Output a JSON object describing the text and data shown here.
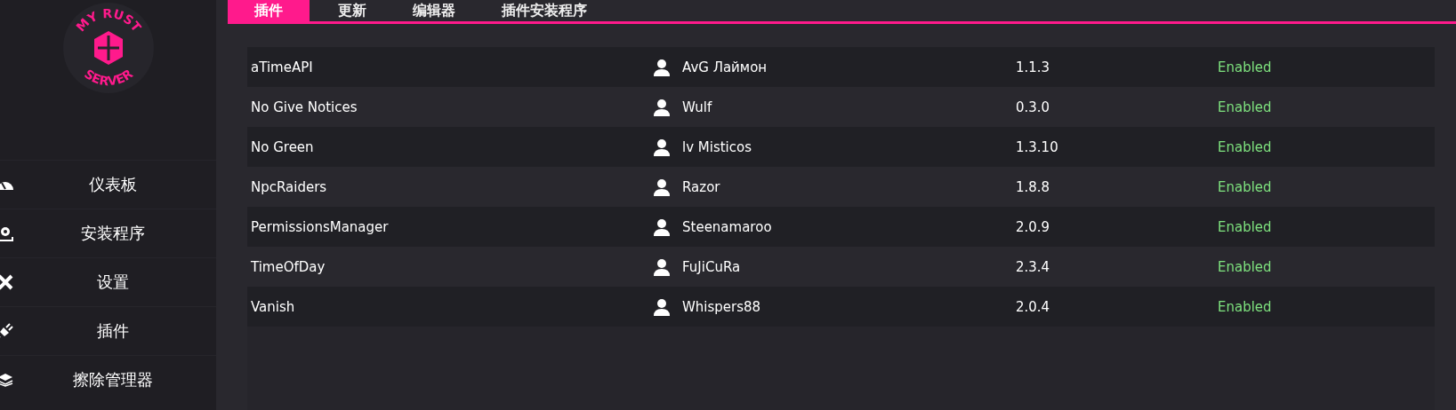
{
  "logo": {
    "top_text": "MY RUST",
    "bottom_text": "SERVER"
  },
  "sidebar": {
    "items": [
      {
        "label": "仪表板"
      },
      {
        "label": "安装程序"
      },
      {
        "label": "设置"
      },
      {
        "label": "插件"
      },
      {
        "label": "擦除管理器"
      }
    ]
  },
  "tabs": [
    {
      "label": "插件",
      "selected": true
    },
    {
      "label": "更新",
      "selected": false
    },
    {
      "label": "编辑器",
      "selected": false
    },
    {
      "label": "插件安装程序",
      "selected": false
    }
  ],
  "plugins": [
    {
      "name": "aTimeAPI",
      "author": "AvG Лаймон",
      "version": "1.1.3",
      "status": "Enabled",
      "enabled": true
    },
    {
      "name": "No Give Notices",
      "author": "Wulf",
      "version": "0.3.0",
      "status": "Enabled",
      "enabled": true
    },
    {
      "name": "No Green",
      "author": "lv Misticos",
      "version": "1.3.10",
      "status": "Enabled",
      "enabled": true
    },
    {
      "name": "NpcRaiders",
      "author": "Razor",
      "version": "1.8.8",
      "status": "Enabled",
      "enabled": true
    },
    {
      "name": "PermissionsManager",
      "author": "Steenamaroo",
      "version": "2.0.9",
      "status": "Enabled",
      "enabled": true
    },
    {
      "name": "TimeOfDay",
      "author": "FuJiCuRa",
      "version": "2.3.4",
      "status": "Enabled",
      "enabled": true
    },
    {
      "name": "Vanish",
      "author": "Whispers88",
      "version": "2.0.4",
      "status": "Enabled",
      "enabled": true
    }
  ]
}
